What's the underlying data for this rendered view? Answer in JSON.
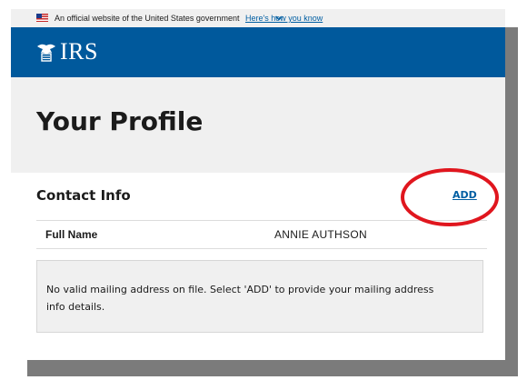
{
  "gov_banner": {
    "text": "An official website of the United States government",
    "link": "Here's how you know",
    "icons": [
      "us-flag-icon",
      "chevron-down-icon"
    ]
  },
  "header": {
    "logo_text": "IRS",
    "logo_icon": "irs-eagle-icon",
    "background": "#00599c"
  },
  "page": {
    "title": "Your Profile"
  },
  "contact_info": {
    "heading": "Contact Info",
    "add_label": "ADD",
    "rows": [
      {
        "label": "Full Name",
        "value": "ANNIE AUTHSON"
      }
    ],
    "notice": "No valid mailing address on file. Select 'ADD' to provide your mailing address info details."
  },
  "annotation": {
    "type": "red-ellipse",
    "color": "#e0161e",
    "target": "ADD"
  }
}
